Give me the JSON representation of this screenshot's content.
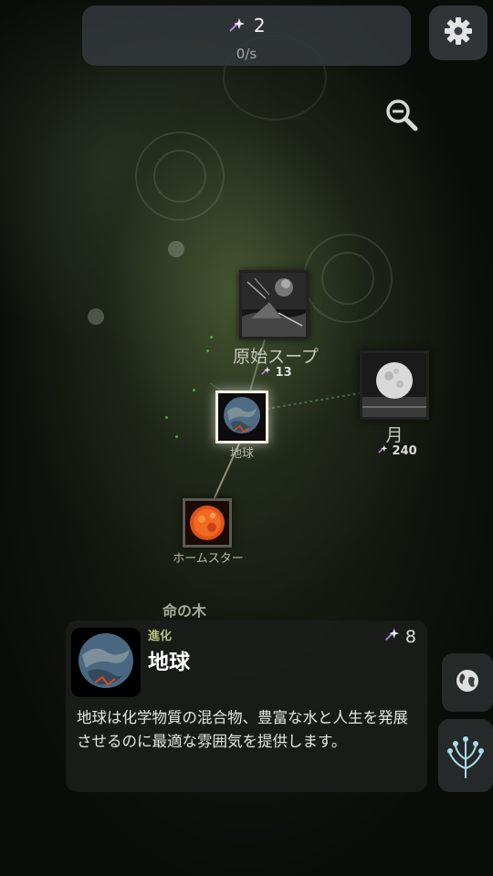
{
  "header": {
    "resource_amount": "2",
    "rate": "0/s"
  },
  "colors": {
    "accent_category": "#b9c27c",
    "spark": "#58d45c",
    "selected_border": "#f3efe0"
  },
  "tree": {
    "nodes": [
      {
        "id": "primordial-soup",
        "label": "原始スープ",
        "cost": "13"
      },
      {
        "id": "moon",
        "label": "月",
        "cost": "240"
      },
      {
        "id": "earth",
        "label": "地球",
        "cost": ""
      },
      {
        "id": "home-star",
        "label": "ホームスター",
        "cost": ""
      }
    ],
    "section_label": "命の木"
  },
  "detail": {
    "category": "進化",
    "title": "地球",
    "cost": "8",
    "description": "地球は化学物質の混合物、豊富な水と人生を発展させるのに最適な雰囲気を提供します。"
  },
  "icons": {
    "resource": "sparkle-comet-icon",
    "settings": "gear-icon",
    "zoom_out": "zoom-out-icon",
    "planet_view": "globe-icon",
    "tree_view": "tree-branches-icon"
  }
}
